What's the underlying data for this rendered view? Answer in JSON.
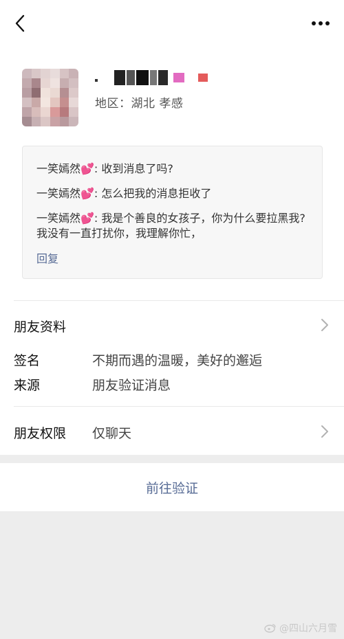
{
  "nav": {
    "back_icon": "chevron-left-icon",
    "more_icon": "ellipsis-icon"
  },
  "profile": {
    "region": "地区：湖北 孝感"
  },
  "messages": {
    "items": [
      "一笑嫣然💕: 收到消息了吗?",
      "一笑嫣然💕: 怎么把我的消息拒收了",
      "一笑嫣然💕: 我是个善良的女孩子，你为什么要拉黑我? 我没有一直打扰你，我理解你忙，"
    ],
    "reply_label": "回复"
  },
  "details": {
    "friend_info_label": "朋友资料",
    "signature_label": "签名",
    "signature_value": "不期而遇的温暖，美好的邂逅",
    "source_label": "来源",
    "source_value": "朋友验证消息",
    "permission_label": "朋友权限",
    "permission_value": "仅聊天"
  },
  "actions": {
    "verify_label": "前往验证"
  },
  "watermark": {
    "text": "@四山六月雪"
  },
  "colors": {
    "link": "#576b95",
    "background": "#ededed",
    "heart": "#e64a9a"
  }
}
